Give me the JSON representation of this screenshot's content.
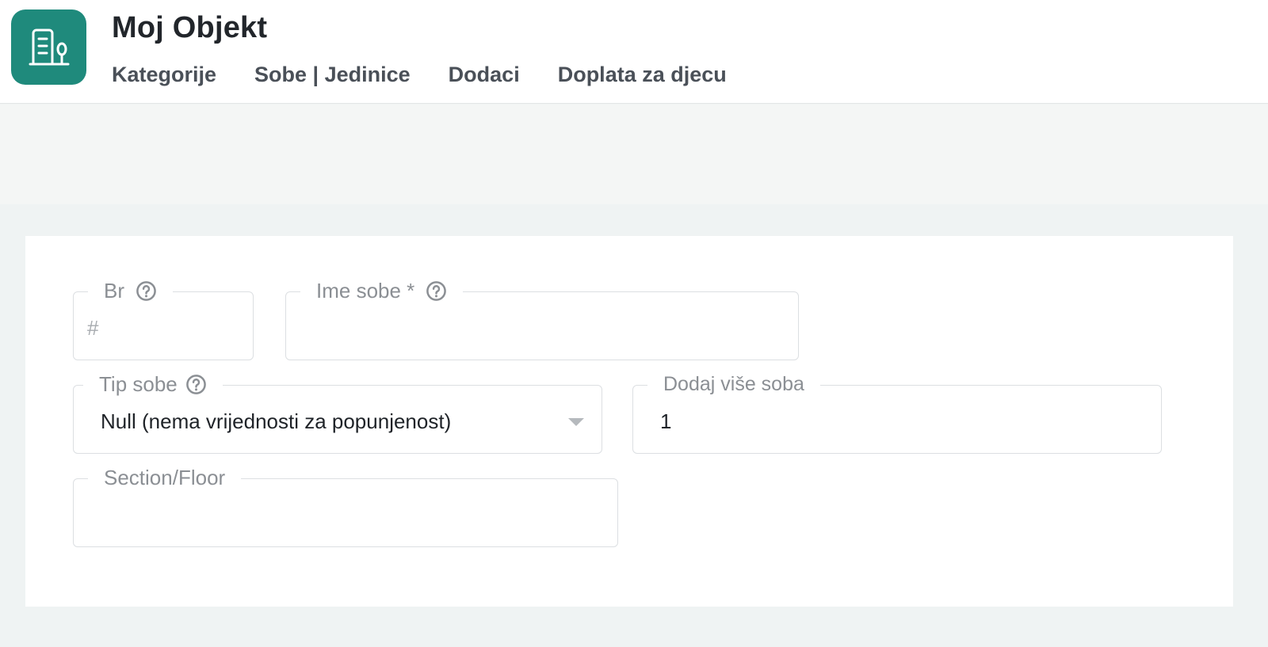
{
  "app": {
    "title": "Moj Objekt",
    "logo_icon": "building-icon",
    "brand_color": "#1f8a7c"
  },
  "nav": {
    "items": [
      {
        "label": "Kategorije"
      },
      {
        "label": "Sobe | Jedinice"
      },
      {
        "label": "Dodaci"
      },
      {
        "label": "Doplata za djecu"
      }
    ]
  },
  "form": {
    "br": {
      "label": "Br",
      "placeholder": "#",
      "icon": "help-circle-icon"
    },
    "ime_sobe": {
      "label": "Ime sobe *",
      "value": "",
      "icon": "help-circle-icon"
    },
    "tip_sobe": {
      "label": "Tip sobe",
      "value": "Null (nema vrijednosti za popunjenost)",
      "icon": "help-circle-icon"
    },
    "dodaj_vise_soba": {
      "label": "Dodaj više soba",
      "value": "1"
    },
    "section_floor": {
      "label": "Section/Floor",
      "value": ""
    }
  }
}
